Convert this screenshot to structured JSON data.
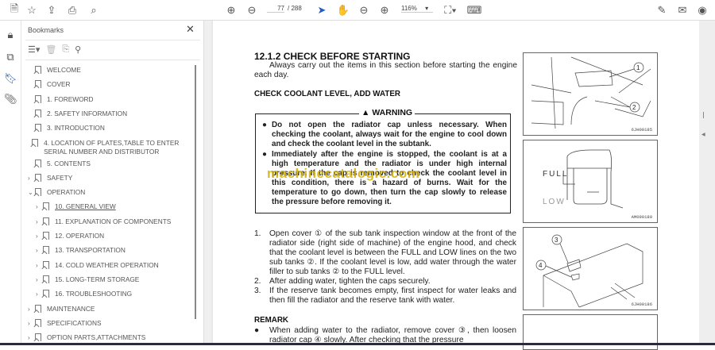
{
  "toolbar": {
    "page_current": "77",
    "page_total": "/ 288",
    "zoom": "116%"
  },
  "bookmarks": {
    "title": "Bookmarks",
    "items": [
      {
        "label": "WELCOME",
        "level": 0,
        "expand": ""
      },
      {
        "label": "COVER",
        "level": 0,
        "expand": ""
      },
      {
        "label": "1. FOREWORD",
        "level": 0,
        "expand": ""
      },
      {
        "label": "2. SAFETY INFORMATION",
        "level": 0,
        "expand": ""
      },
      {
        "label": "3. INTRODUCTION",
        "level": 0,
        "expand": ""
      },
      {
        "label": "4. LOCATION OF PLATES,TABLE TO ENTER SERIAL NUMBER AND DISTRIBUTOR",
        "level": 0,
        "expand": ""
      },
      {
        "label": "5. CONTENTS",
        "level": 0,
        "expand": ""
      },
      {
        "label": "SAFETY",
        "level": 0,
        "expand": ">"
      },
      {
        "label": "OPERATION",
        "level": 0,
        "expand": "v"
      },
      {
        "label": "10. GENERAL VIEW",
        "level": 1,
        "expand": ">"
      },
      {
        "label": "11. EXPLANATION OF COMPONENTS",
        "level": 1,
        "expand": ">"
      },
      {
        "label": "12. OPERATION",
        "level": 1,
        "expand": ">"
      },
      {
        "label": "13. TRANSPORTATION",
        "level": 1,
        "expand": ">"
      },
      {
        "label": "14. COLD WEATHER OPERATION",
        "level": 1,
        "expand": ">"
      },
      {
        "label": "15. LONG-TERM STORAGE",
        "level": 1,
        "expand": ">"
      },
      {
        "label": "16. TROUBLESHOOTING",
        "level": 1,
        "expand": ">"
      },
      {
        "label": "MAINTENANCE",
        "level": 0,
        "expand": ">"
      },
      {
        "label": "SPECIFICATIONS",
        "level": 0,
        "expand": ">"
      },
      {
        "label": "OPTION PARTS,ATTACHMENTS",
        "level": 0,
        "expand": ">"
      }
    ]
  },
  "doc": {
    "heading": "12.1.2 CHECK BEFORE STARTING",
    "intro": "Always carry out the items in this section before starting the engine each day.",
    "subheading": "CHECK COOLANT LEVEL, ADD WATER",
    "warning_title": "WARNING",
    "warnings": [
      "Do not open the radiator cap unless necessary. When checking the coolant, always wait for the engine to cool down and check the coolant level in the subtank.",
      "Immediately after the engine is stopped, the coolant is at a high temperature and the radiator is under high internal pressure. If the cap is removed to check the coolant level in this condition, there is a hazard of burns. Wait for the temperature to go down, then turn the cap slowly to release the pressure before removing it."
    ],
    "watermark": "machinecatalogic.com",
    "steps": [
      {
        "n": "1.",
        "text": "Open cover ① of the sub tank inspection window at the front of the radiator side (right side of machine) of the engine hood, and check that the coolant level is between the FULL and LOW lines on the two sub tanks ②. If the coolant level is low, add water through the water filler to sub tanks ② to the FULL level."
      },
      {
        "n": "2.",
        "text": "After adding water, tighten the caps securely."
      },
      {
        "n": "3.",
        "text": "If the reserve tank becomes empty, first inspect for water leaks and then fill the radiator and the reserve tank with water."
      }
    ],
    "remark_title": "REMARK",
    "remark": "When adding water to the radiator, remove cover ③, then loosen radiator cap ④ slowly. After checking that the pressure",
    "figures": [
      {
        "caption": "6JH00185",
        "callouts": [
          "1",
          "2"
        ]
      },
      {
        "caption": "AM090180",
        "labels": [
          "FULL",
          "LOW"
        ]
      },
      {
        "caption": "6JH00186",
        "callouts": [
          "3",
          "4"
        ]
      }
    ]
  }
}
